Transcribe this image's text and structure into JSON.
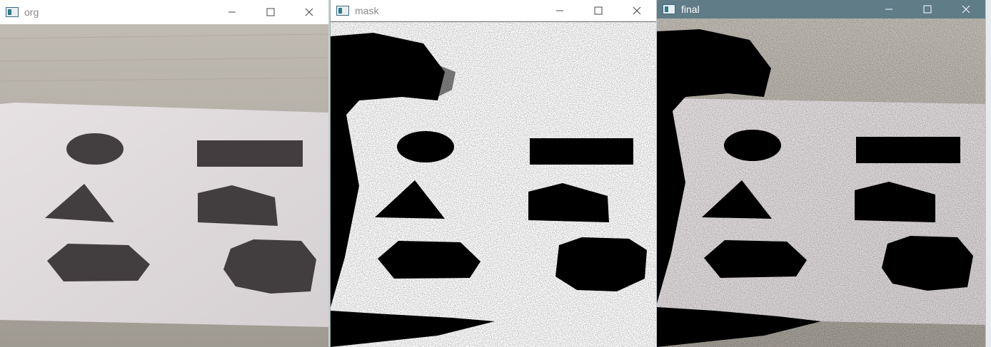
{
  "windows": [
    {
      "id": "org",
      "title": "org",
      "active": false,
      "controls": [
        "minimize-icon",
        "maximize-icon",
        "close-icon"
      ]
    },
    {
      "id": "mask",
      "title": "mask",
      "active": false,
      "controls": [
        "minimize-icon",
        "maximize-icon",
        "close-icon"
      ]
    },
    {
      "id": "final",
      "title": "final",
      "active": true,
      "controls": [
        "minimize-icon",
        "maximize-icon",
        "close-icon"
      ]
    }
  ],
  "colors": {
    "inactive_titlebar": "#ffffff",
    "active_titlebar": "#5f7c87",
    "inactive_title_text": "#8a8a8a",
    "active_title_text": "#ffffff",
    "desk": "#b6b2ab",
    "paper": "#e9e4e3",
    "shape_gray": "#3a3537",
    "mask_black": "#000000"
  }
}
